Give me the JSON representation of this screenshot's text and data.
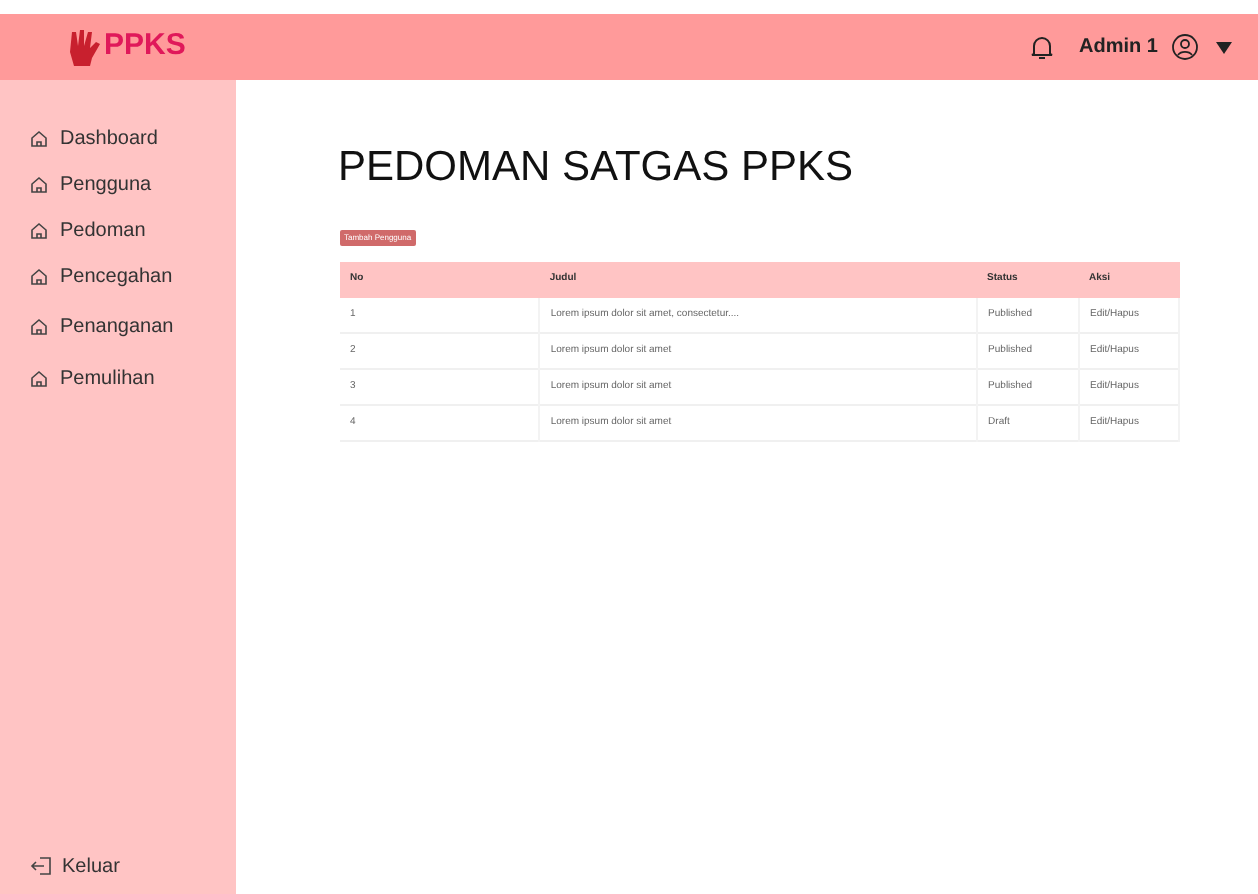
{
  "header": {
    "logo": "PPKS",
    "user": "Admin 1"
  },
  "sidebar": {
    "items": [
      "Dashboard",
      "Pengguna",
      "Pedoman",
      "Pencegahan",
      "Penanganan",
      "Pemulihan"
    ],
    "logout": "Keluar"
  },
  "page": {
    "title": "PEDOMAN SATGAS PPKS",
    "add_button": "Tambah Pengguna"
  },
  "table": {
    "columns": [
      "No",
      "Judul",
      "Status",
      "Aksi"
    ],
    "rows": [
      [
        "1",
        "Lorem ipsum dolor sit amet, consectetur....",
        "Published",
        "Edit/Hapus"
      ],
      [
        "2",
        "Lorem ipsum dolor sit amet",
        "Published",
        "Edit/Hapus"
      ],
      [
        "3",
        "Lorem ipsum dolor sit amet",
        "Published",
        "Edit/Hapus"
      ],
      [
        "4",
        "Lorem ipsum dolor sit amet",
        "Draft",
        "Edit/Hapus"
      ]
    ]
  }
}
